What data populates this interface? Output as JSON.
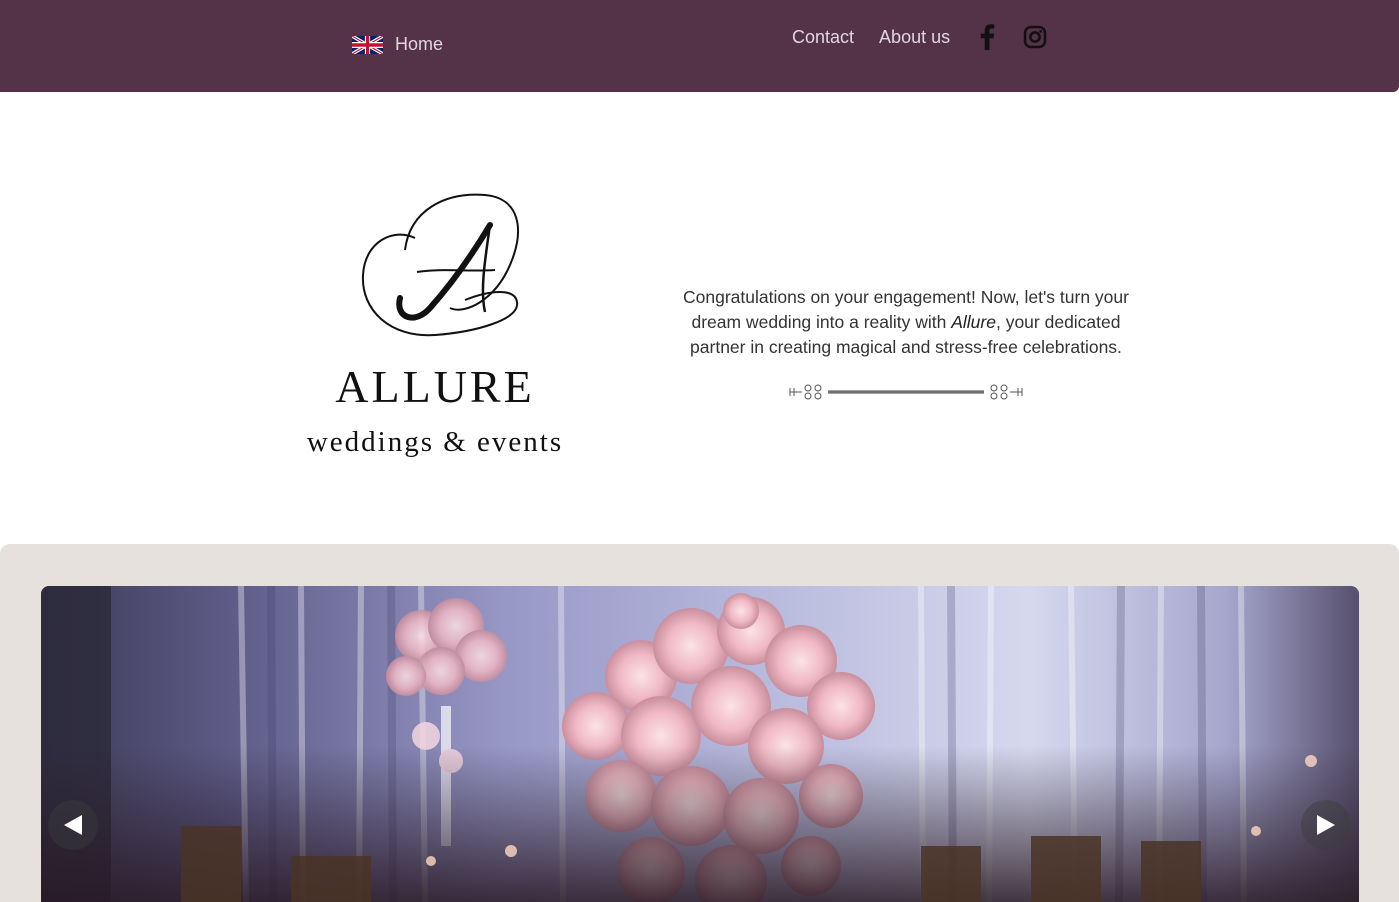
{
  "nav": {
    "home_label": "Home",
    "contact_label": "Contact",
    "about_label": "About us",
    "language_flag": "uk-flag-icon",
    "social": [
      "facebook-icon",
      "instagram-icon"
    ],
    "bar_color": "#543247"
  },
  "hero": {
    "brand_name": "ALLURE",
    "brand_tagline": "weddings & events",
    "intro_before": "Congratulations on your engagement! Now, let's turn your dream wedding into a reality with ",
    "intro_emphasis": "Allure",
    "intro_after": ", your dedicated partner in creating magical and stress-free celebrations."
  },
  "gallery": {
    "background": "#e6e1dd",
    "prev_icon": "arrow-left-icon",
    "next_icon": "arrow-right-icon"
  }
}
